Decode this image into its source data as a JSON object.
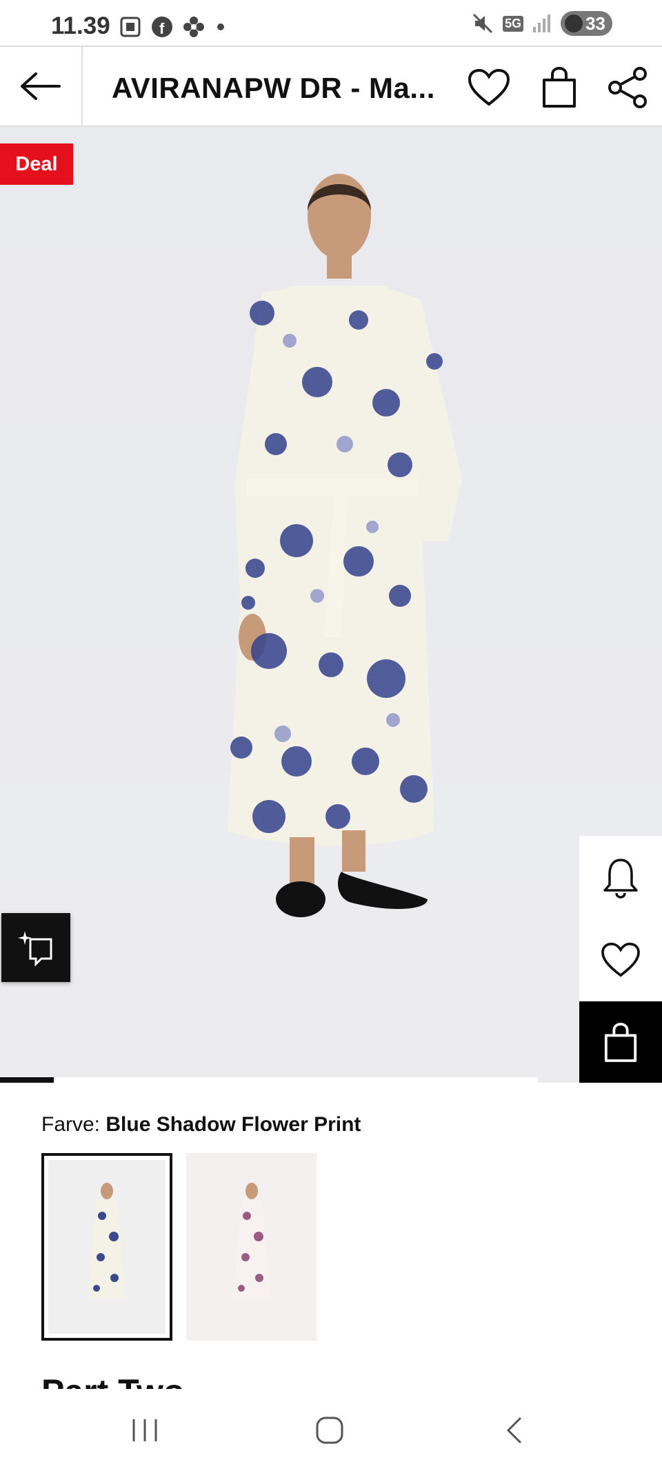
{
  "status_bar": {
    "time": "11.39",
    "left_icons": [
      "screenshot-icon",
      "facebook-icon",
      "flower-icon",
      "dot-icon"
    ],
    "network": "5G",
    "battery": "33"
  },
  "header": {
    "title": "AVIRANAPW DR - Ma...",
    "icons": [
      "back-arrow-icon",
      "heart-icon",
      "bag-icon",
      "share-icon"
    ]
  },
  "product": {
    "badge": "Deal",
    "carousel_progress": 0.1,
    "floating_actions": [
      "bell-icon",
      "heart-icon",
      "bag-icon"
    ],
    "color_label": "Farve:",
    "color_value": "Blue Shadow Flower Print",
    "swatches": [
      {
        "name": "blue",
        "selected": true,
        "accent": "#3b4a8f"
      },
      {
        "name": "pink",
        "selected": false,
        "accent": "#9a5c80"
      }
    ],
    "brand": "Part Two"
  },
  "colors": {
    "deal_red": "#e4111c",
    "dress_base": "#f4f1e6",
    "print_blue": "#34428c"
  },
  "navbar": {
    "buttons": [
      "recents-icon",
      "home-icon",
      "back-icon"
    ]
  }
}
